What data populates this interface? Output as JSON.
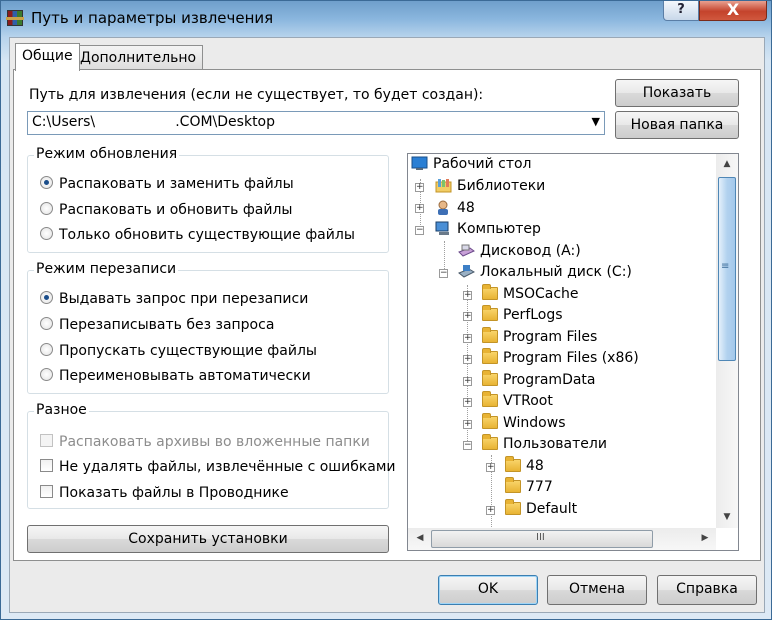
{
  "window": {
    "title": "Путь и параметры извлечения",
    "help_label": "?",
    "close_label": "X"
  },
  "tabs": [
    {
      "label": "Общие",
      "active": true
    },
    {
      "label": "Дополнительно",
      "active": false
    }
  ],
  "path": {
    "label": "Путь для извлечения (если не существует, то будет создан):",
    "value": "C:\\Users\\                  .COM\\Desktop"
  },
  "buttons": {
    "show": "Показать",
    "new_folder": "Новая папка",
    "save_settings": "Сохранить установки",
    "ok": "OK",
    "cancel": "Отмена",
    "help": "Справка"
  },
  "update_mode": {
    "title": "Режим обновления",
    "options": [
      {
        "label": "Распаковать и заменить файлы",
        "selected": true
      },
      {
        "label": "Распаковать и обновить файлы",
        "selected": false
      },
      {
        "label": "Только обновить существующие файлы",
        "selected": false
      }
    ]
  },
  "overwrite_mode": {
    "title": "Режим перезаписи",
    "options": [
      {
        "label": "Выдавать запрос при перезаписи",
        "selected": true
      },
      {
        "label": "Перезаписывать без запроса",
        "selected": false
      },
      {
        "label": "Пропускать существующие файлы",
        "selected": false
      },
      {
        "label": "Переименовывать автоматически",
        "selected": false
      }
    ]
  },
  "misc": {
    "title": "Разное",
    "options": [
      {
        "label": "Распаковать архивы во вложенные папки",
        "checked": false,
        "disabled": true
      },
      {
        "label": "Не удалять файлы, извлечённые с ошибками",
        "checked": false,
        "disabled": false
      },
      {
        "label": "Показать файлы в Проводнике",
        "checked": false,
        "disabled": false
      }
    ]
  },
  "tree": {
    "items": [
      {
        "label": "Рабочий стол",
        "icon": "desktop-icon",
        "expander": ""
      },
      {
        "label": "Библиотеки",
        "icon": "libraries-icon",
        "expander": "+"
      },
      {
        "label": "48",
        "icon": "user-icon",
        "expander": "+"
      },
      {
        "label": "Компьютер",
        "icon": "computer-icon",
        "expander": "−"
      },
      {
        "label": "Дисковод (A:)",
        "icon": "floppy-drive-icon",
        "expander": ""
      },
      {
        "label": "Локальный диск (C:)",
        "icon": "hard-drive-icon",
        "expander": "−"
      },
      {
        "label": "MSOCache",
        "icon": "folder-icon",
        "expander": "+"
      },
      {
        "label": "PerfLogs",
        "icon": "folder-icon",
        "expander": "+"
      },
      {
        "label": "Program Files",
        "icon": "folder-icon",
        "expander": "+"
      },
      {
        "label": "Program Files (x86)",
        "icon": "folder-icon",
        "expander": "+"
      },
      {
        "label": "ProgramData",
        "icon": "folder-icon",
        "expander": "+"
      },
      {
        "label": "VTRoot",
        "icon": "folder-icon",
        "expander": "+"
      },
      {
        "label": "Windows",
        "icon": "folder-icon",
        "expander": "+"
      },
      {
        "label": "Пользователи",
        "icon": "folder-icon",
        "expander": "−"
      },
      {
        "label": "48",
        "icon": "folder-icon",
        "expander": "+"
      },
      {
        "label": "777",
        "icon": "folder-icon",
        "expander": ""
      },
      {
        "label": "Default",
        "icon": "folder-icon",
        "expander": "+"
      }
    ]
  },
  "scroll": {
    "grip": "≡",
    "hgrip": "III",
    "up": "▲",
    "down": "▼",
    "left": "◀",
    "right": "▶"
  }
}
